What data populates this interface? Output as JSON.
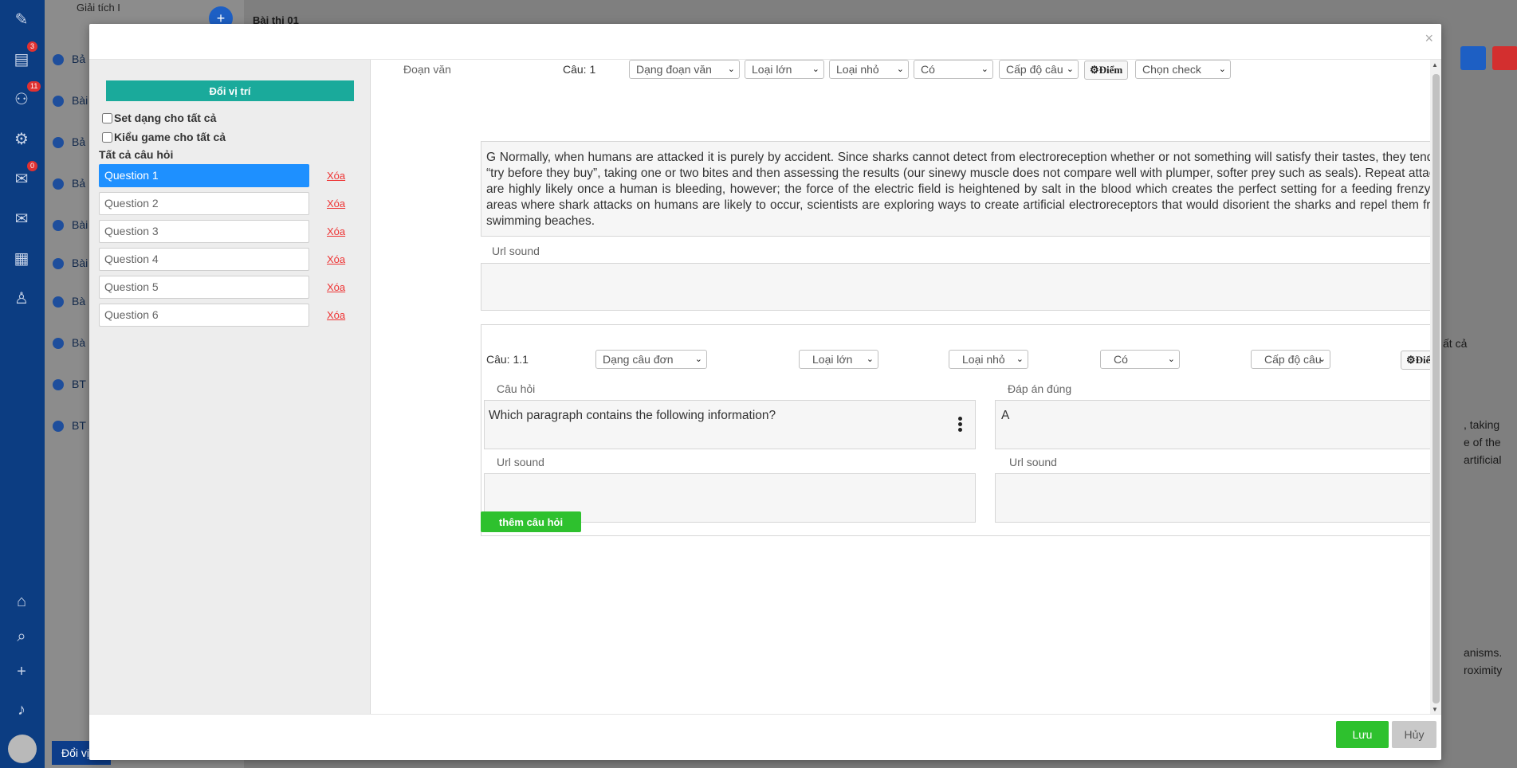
{
  "background": {
    "subject": "Giải tích I",
    "exam_title": "Bài thi 01",
    "rail_badges": [
      "3",
      "11",
      "0"
    ],
    "menu_items": [
      "Bả",
      "Bài",
      "Bả",
      "Bả",
      "Bài",
      "Bài",
      "Bà",
      "Bà",
      "BT",
      "BT"
    ],
    "right_fragments": [
      ", taking",
      "e of the",
      "artificial",
      "anisms.",
      "roximity"
    ],
    "tat_ca_fragment": "ất cả",
    "remove_fragment": "Xóa",
    "doi_vi_fragment": "Đổi vị"
  },
  "modal": {
    "close_symbol": "×",
    "left": {
      "swap_button": "Đổi vị trí",
      "set_type_all": "Set dạng cho tất cả",
      "game_type_all": "Kiểu game cho tất cả",
      "all_questions_title": "Tất cả câu hỏi",
      "delete_label": "Xóa",
      "questions": [
        "Question 1",
        "Question 2",
        "Question 3",
        "Question 4",
        "Question 5",
        "Question 6"
      ],
      "active_index": 0
    },
    "passage": {
      "label": "Đoạn văn",
      "question_no": "Câu: 1",
      "type_select": "Dạng đoạn văn",
      "big_category": "Loại lớn",
      "small_category": "Loại nhỏ",
      "has_option": "Có",
      "level_select": "Cấp độ câu",
      "score_button": "Điểm",
      "check_select": "Chọn check",
      "text": "G   Normally, when humans are attacked it is purely by accident. Since sharks cannot detect from electroreception whether or not something will satisfy their tastes, they tend to “try before they buy”, taking one or two bites and then assessing the results (our sinewy muscle does not compare well with plumper, softer prey such as seals). Repeat attacks are highly likely once a human is bleeding, however; the force of the electric field is heightened by salt in the blood which creates the perfect setting for a feeding frenzy.  In areas where shark attacks on humans are likely to occur, scientists are exploring ways to create artificial electroreceptors that would disorient the sharks and repel them from swimming beaches.",
      "url_sound_label": "Url sound"
    },
    "sub_question": {
      "number": "Câu: 1.1",
      "type_select": "Dạng câu đơn",
      "big_category": "Loại lớn",
      "small_category": "Loại nhỏ",
      "has_option": "Có",
      "level_select": "Cấp độ câu",
      "score_button": "Điểm",
      "question_label": "Câu hỏi",
      "question_text": "Which paragraph contains the following information?",
      "answer_label": "Đáp án đúng",
      "answer_text": "A",
      "url_sound_label": "Url sound"
    },
    "add_question_button": "thêm câu hỏi",
    "save_button": "Lưu",
    "cancel_button": "Hủy"
  }
}
